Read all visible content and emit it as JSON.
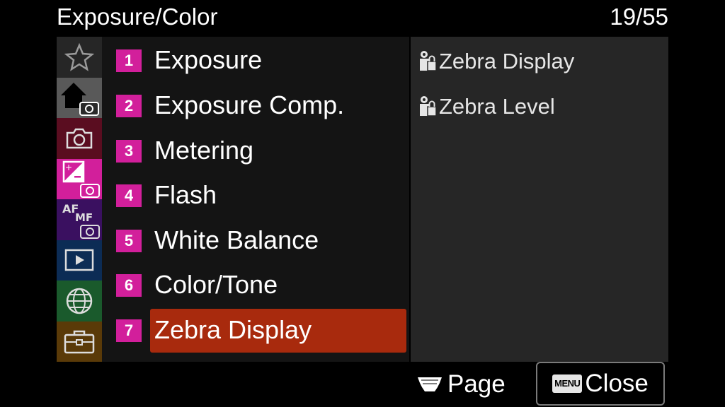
{
  "header": {
    "title": "Exposure/Color",
    "page_counter": "19/55"
  },
  "side_tabs": [
    {
      "name": "tab-favorites",
      "icon": "star-icon",
      "bg": "#262626"
    },
    {
      "name": "tab-main",
      "icon": "home-camera-icon",
      "bg": "#595959"
    },
    {
      "name": "tab-shooting",
      "icon": "camera-icon",
      "bg": "#5a0d20"
    },
    {
      "name": "tab-exposure-color",
      "icon": "exposure-comp-icon",
      "bg": "#d21f9b"
    },
    {
      "name": "tab-focus",
      "icon": "af-mf-icon",
      "bg": "#3a1060"
    },
    {
      "name": "tab-playback",
      "icon": "playback-icon",
      "bg": "#0c2c55"
    },
    {
      "name": "tab-network",
      "icon": "globe-icon",
      "bg": "#1a5a2c"
    },
    {
      "name": "tab-setup",
      "icon": "toolbox-icon",
      "bg": "#5a3a08"
    }
  ],
  "menu": {
    "items": [
      {
        "num": "1",
        "label": "Exposure"
      },
      {
        "num": "2",
        "label": "Exposure Comp."
      },
      {
        "num": "3",
        "label": "Metering"
      },
      {
        "num": "4",
        "label": "Flash"
      },
      {
        "num": "5",
        "label": "White Balance"
      },
      {
        "num": "6",
        "label": "Color/Tone"
      },
      {
        "num": "7",
        "label": "Zebra Display"
      }
    ],
    "selected_index": 6
  },
  "submenu": {
    "items": [
      {
        "label": "Zebra Display",
        "icon": "movie-lock-icon"
      },
      {
        "label": "Zebra Level",
        "icon": "movie-lock-icon"
      }
    ]
  },
  "footer": {
    "page_label": "Page",
    "page_icon": "dial-icon",
    "menu_badge": "MENU",
    "close_label": "Close"
  }
}
